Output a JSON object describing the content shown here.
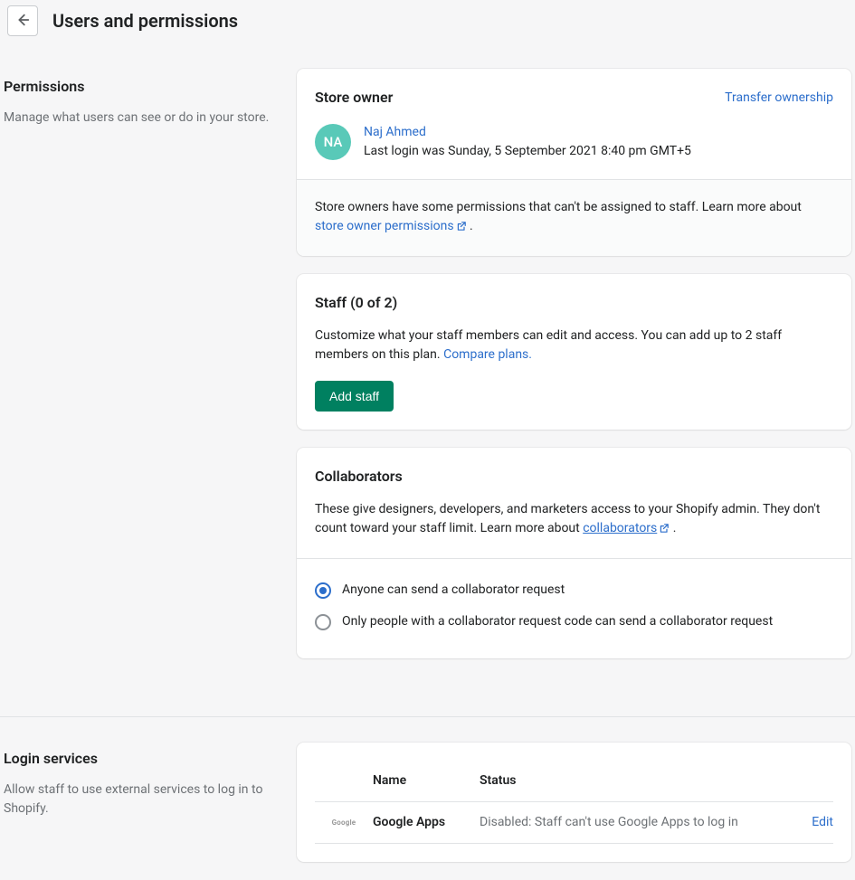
{
  "header": {
    "title": "Users and permissions"
  },
  "permissions": {
    "heading": "Permissions",
    "description": "Manage what users can see or do in your store."
  },
  "store_owner": {
    "title": "Store owner",
    "transfer_link": "Transfer ownership",
    "avatar_initials": "NA",
    "name": "Naj Ahmed",
    "last_login": "Last login was Sunday, 5 September 2021 8:40 pm GMT+5",
    "footer_text_a": "Store owners have some permissions that can't be assigned to staff. Learn more about ",
    "footer_link": "store owner permissions",
    "footer_text_b": " ."
  },
  "staff": {
    "title": "Staff (0 of 2)",
    "description_a": "Customize what your staff members can edit and access. You can add up to 2 staff members on this plan. ",
    "compare_link": "Compare plans.",
    "add_button": "Add staff"
  },
  "collaborators": {
    "title": "Collaborators",
    "description_a": "These give designers, developers, and marketers access to your Shopify admin. They don't count toward your staff limit. Learn more about ",
    "link": "collaborators",
    "description_b": " .",
    "radio_options": [
      {
        "label": "Anyone can send a collaborator request",
        "selected": true
      },
      {
        "label": "Only people with a collaborator request code can send a collaborator request",
        "selected": false
      }
    ]
  },
  "login_services": {
    "heading": "Login services",
    "description": "Allow staff to use external services to log in to Shopify.",
    "table": {
      "columns": {
        "name": "Name",
        "status": "Status"
      },
      "rows": [
        {
          "logo": "Google",
          "name": "Google Apps",
          "status": "Disabled: Staff can't use Google Apps to log in",
          "action": "Edit"
        }
      ]
    }
  }
}
